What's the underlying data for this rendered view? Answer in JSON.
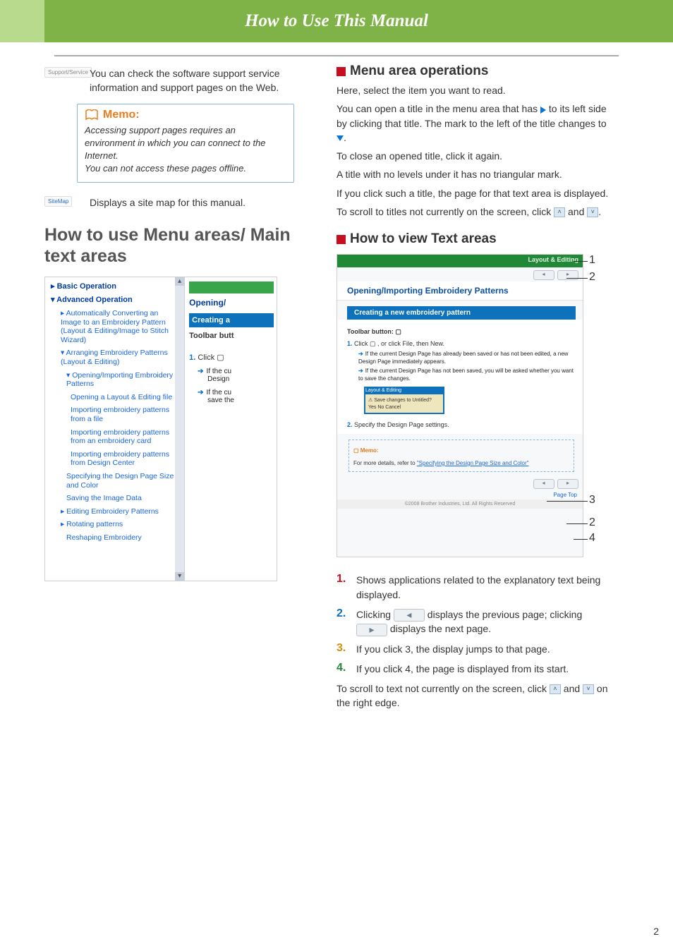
{
  "header": {
    "title": "How to Use This Manual"
  },
  "left": {
    "support": {
      "button_label": "Support/Service",
      "text": "You can check the software support service information and support pages on the Web."
    },
    "memo": {
      "title": "Memo:",
      "body1": "Accessing support pages requires an environment in which you can connect to the Internet.",
      "body2": "You can not access these pages offline."
    },
    "sitemap": {
      "button_label": "SiteMap",
      "text": "Displays a site map for this manual."
    },
    "section_title": "How to use Menu areas/ Main text areas",
    "menu": {
      "items": [
        {
          "cls": "b",
          "text": "▸ Basic Operation"
        },
        {
          "cls": "b",
          "text": "▾ Advanced Operation"
        },
        {
          "cls": "sub",
          "text": "▸ Automatically Converting an Image to an Embroidery Pattern (Layout & Editing/Image to Stitch Wizard)"
        },
        {
          "cls": "sub",
          "text": "▾ Arranging Embroidery Patterns (Layout & Editing)"
        },
        {
          "cls": "sub2",
          "text": "▾ Opening/Importing Embroidery Patterns"
        },
        {
          "cls": "sub3",
          "text": "Opening a Layout & Editing file"
        },
        {
          "cls": "sub3",
          "text": "Importing embroidery patterns from a file"
        },
        {
          "cls": "sub3",
          "text": "Importing embroidery patterns from an embroidery card"
        },
        {
          "cls": "sub3",
          "text": "Importing embroidery patterns from Design Center"
        },
        {
          "cls": "sub2",
          "text": "Specifying the Design Page Size and Color"
        },
        {
          "cls": "sub2",
          "text": "Saving the Image Data"
        },
        {
          "cls": "sub",
          "text": "▸ Editing Embroidery Patterns"
        },
        {
          "cls": "sub",
          "text": "▸ Rotating patterns"
        },
        {
          "cls": "sub2",
          "text": "Reshaping Embroidery"
        }
      ]
    },
    "textarea": {
      "greenbar": "",
      "title": "Opening/",
      "bar": "Creating a",
      "toolbar": "Toolbar butt",
      "step": "1.",
      "steptxt": "Click  ▢",
      "note1": "If the cu",
      "note1b": "Design",
      "note2": "If the cu",
      "note2b": "save the"
    }
  },
  "right": {
    "menu_ops": {
      "heading": "Menu area operations",
      "p1": "Here, select the item you want to read.",
      "p2a": "You can open a title in the menu area that has ",
      "p2b": " to its left side by clicking that title. The mark to the left of the title changes to ",
      "p2c": ".",
      "p3": "To close an opened title, click it again.",
      "p4": "A title with no levels under it has no triangular mark.",
      "p5": "If you click such a title, the page for that text area is displayed.",
      "p6a": "To scroll to titles not currently on the screen, click ",
      "p6b": " and ",
      "p6c": "."
    },
    "text_areas": {
      "heading": "How to view Text areas",
      "shot": {
        "greenbar": "Layout & Editing",
        "title": "Opening/Importing Embroidery Patterns",
        "sec": "Creating a new embroidery pattern",
        "toolbar": "Toolbar button:  ▢",
        "step1": "1.",
        "step1txt": " Click  ▢ , or click File, then New.",
        "b1": "If the current Design Page has already been saved or has not been edited, a new Design Page immediately appears.",
        "b2": "If the current Design Page has not been saved, you will be asked whether you want to save the changes.",
        "dlg_title": "Layout & Editing",
        "dlg_body": "Save changes to Untitled?",
        "dlg_buttons": "Yes        No        Cancel",
        "step2": "2.",
        "step2txt": " Specify the Design Page settings.",
        "memo_h": "Memo:",
        "memo_t": "For more details, refer to ",
        "memo_l": "\"Specifying the Design Page Size and Color\"",
        "foot": "Page Top",
        "copy": "©2008 Brother Industries, Ltd. All Rights Reserved"
      },
      "callouts": {
        "c1": "1",
        "c2": "2",
        "c3": "3",
        "c4": "4"
      },
      "list": {
        "n1": "1.",
        "t1": "Shows applications related to the explanatory text being displayed.",
        "n2": "2.",
        "t2a": "Clicking ",
        "t2b": " displays the previous page; clicking ",
        "t2c": " displays the next page.",
        "n3": "3.",
        "t3": "If you click 3, the display jumps to that page.",
        "n4": "4.",
        "t4": "If you click 4, the page is displayed from its start."
      },
      "tail_a": "To scroll to text not currently on the screen, click ",
      "tail_b": " and ",
      "tail_c": " on the right edge."
    }
  },
  "page_number": "2"
}
